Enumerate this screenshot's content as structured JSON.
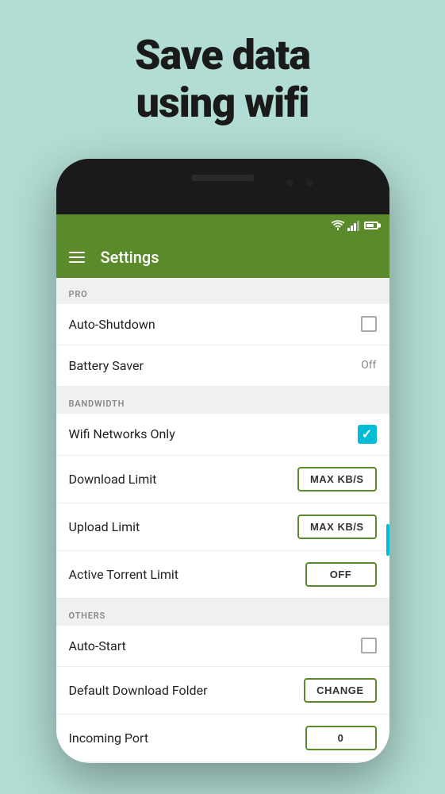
{
  "header": {
    "line1": "Save data",
    "line2": "using wifi"
  },
  "toolbar": {
    "title": "Settings"
  },
  "sections": {
    "pro": {
      "header": "PRO",
      "items": [
        {
          "label": "Auto-Shutdown",
          "value_type": "checkbox",
          "checked": false
        },
        {
          "label": "Battery Saver",
          "value_type": "text",
          "value": "Off"
        }
      ]
    },
    "bandwidth": {
      "header": "BANDWIDTH",
      "items": [
        {
          "label": "Wifi Networks Only",
          "value_type": "checkbox_checked",
          "checked": true
        },
        {
          "label": "Download Limit",
          "value_type": "button",
          "btn_label": "MAX KB/S"
        },
        {
          "label": "Upload Limit",
          "value_type": "button",
          "btn_label": "MAX KB/S"
        },
        {
          "label": "Active Torrent Limit",
          "value_type": "button",
          "btn_label": "OFF"
        }
      ]
    },
    "others": {
      "header": "OTHERS",
      "items": [
        {
          "label": "Auto-Start",
          "value_type": "checkbox",
          "checked": false
        },
        {
          "label": "Default Download Folder",
          "value_type": "button",
          "btn_label": "CHANGE"
        },
        {
          "label": "Incoming Port",
          "value_type": "button",
          "btn_label": "0"
        }
      ]
    }
  }
}
